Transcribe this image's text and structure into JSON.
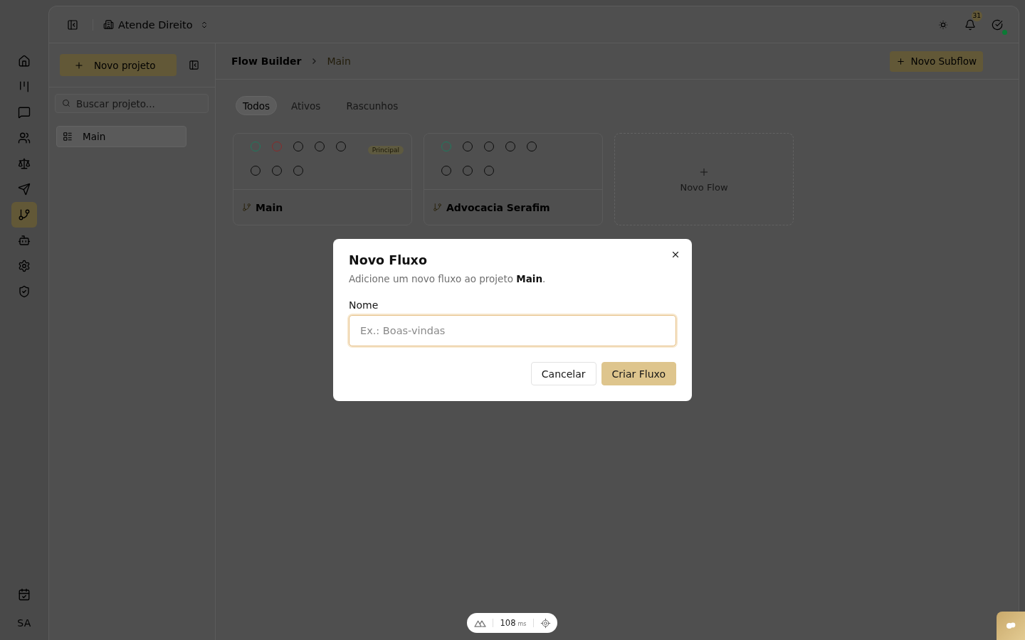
{
  "rail": {
    "items": [
      {
        "kind": "home",
        "selected": false
      },
      {
        "kind": "kanban",
        "selected": false
      },
      {
        "kind": "chat",
        "selected": false
      },
      {
        "kind": "users",
        "selected": false
      },
      {
        "kind": "scale",
        "selected": false
      },
      {
        "kind": "send",
        "selected": false
      },
      {
        "kind": "flows",
        "selected": true
      },
      {
        "kind": "bot",
        "selected": false
      },
      {
        "kind": "settings",
        "selected": false
      },
      {
        "kind": "shield",
        "selected": false
      }
    ],
    "bottom_items": [
      {
        "kind": "calendar",
        "selected": false
      }
    ],
    "avatar": "SA"
  },
  "topbar": {
    "workspace": "Atende Direito",
    "notifications": "31",
    "online": true
  },
  "projects": {
    "new_button": "Novo projeto",
    "search": {
      "placeholder": "Buscar projeto..."
    },
    "items": [
      {
        "name": "Main",
        "selected": true
      }
    ]
  },
  "breadcrumb": [
    "Flow Builder",
    "Main"
  ],
  "new_subflow_button": "Novo Subflow",
  "filters": [
    {
      "label": "Todos",
      "selected": true
    },
    {
      "label": "Ativos",
      "selected": false
    },
    {
      "label": "Rascunhos",
      "selected": false
    }
  ],
  "flows": [
    {
      "name": "Main",
      "badge": "Principal",
      "rows": [
        {
          "nodes": [
            {
              "color": "#1e7a5e"
            },
            {
              "color": "#8a2a2a"
            },
            {
              "color": "#0c0c0c"
            },
            {
              "color": "#0c0c0c"
            },
            {
              "color": "#0c0c0c"
            }
          ]
        },
        {
          "nodes": [
            {
              "color": "#0c0c0c"
            },
            {
              "color": "#0c0c0c"
            },
            {
              "color": "#0c0c0c"
            }
          ]
        }
      ]
    },
    {
      "name": "Advocacia Serafim",
      "rows": [
        {
          "nodes": [
            {
              "color": "#1e7a5e"
            },
            {
              "color": "#0c0c0c"
            },
            {
              "color": "#0c0c0c"
            },
            {
              "color": "#0c0c0c"
            },
            {
              "color": "#0c0c0c"
            }
          ]
        },
        {
          "nodes": [
            {
              "color": "#0c0c0c"
            },
            {
              "color": "#0c0c0c"
            },
            {
              "color": "#0c0c0c"
            }
          ]
        }
      ]
    }
  ],
  "new_flow": "Novo Flow",
  "dialog": {
    "title": "Novo Fluxo",
    "description": "Adicione um novo fluxo ao projeto **Main**.",
    "field_label": "Nome",
    "field": {
      "placeholder": "Ex.: Boas-vindas"
    },
    "buttons": [
      {
        "label": "Cancelar",
        "kind": "secondary"
      },
      {
        "label": "Criar Fluxo",
        "kind": "primary"
      }
    ]
  },
  "devtools": {
    "reading": "108",
    "unit": "ms"
  }
}
